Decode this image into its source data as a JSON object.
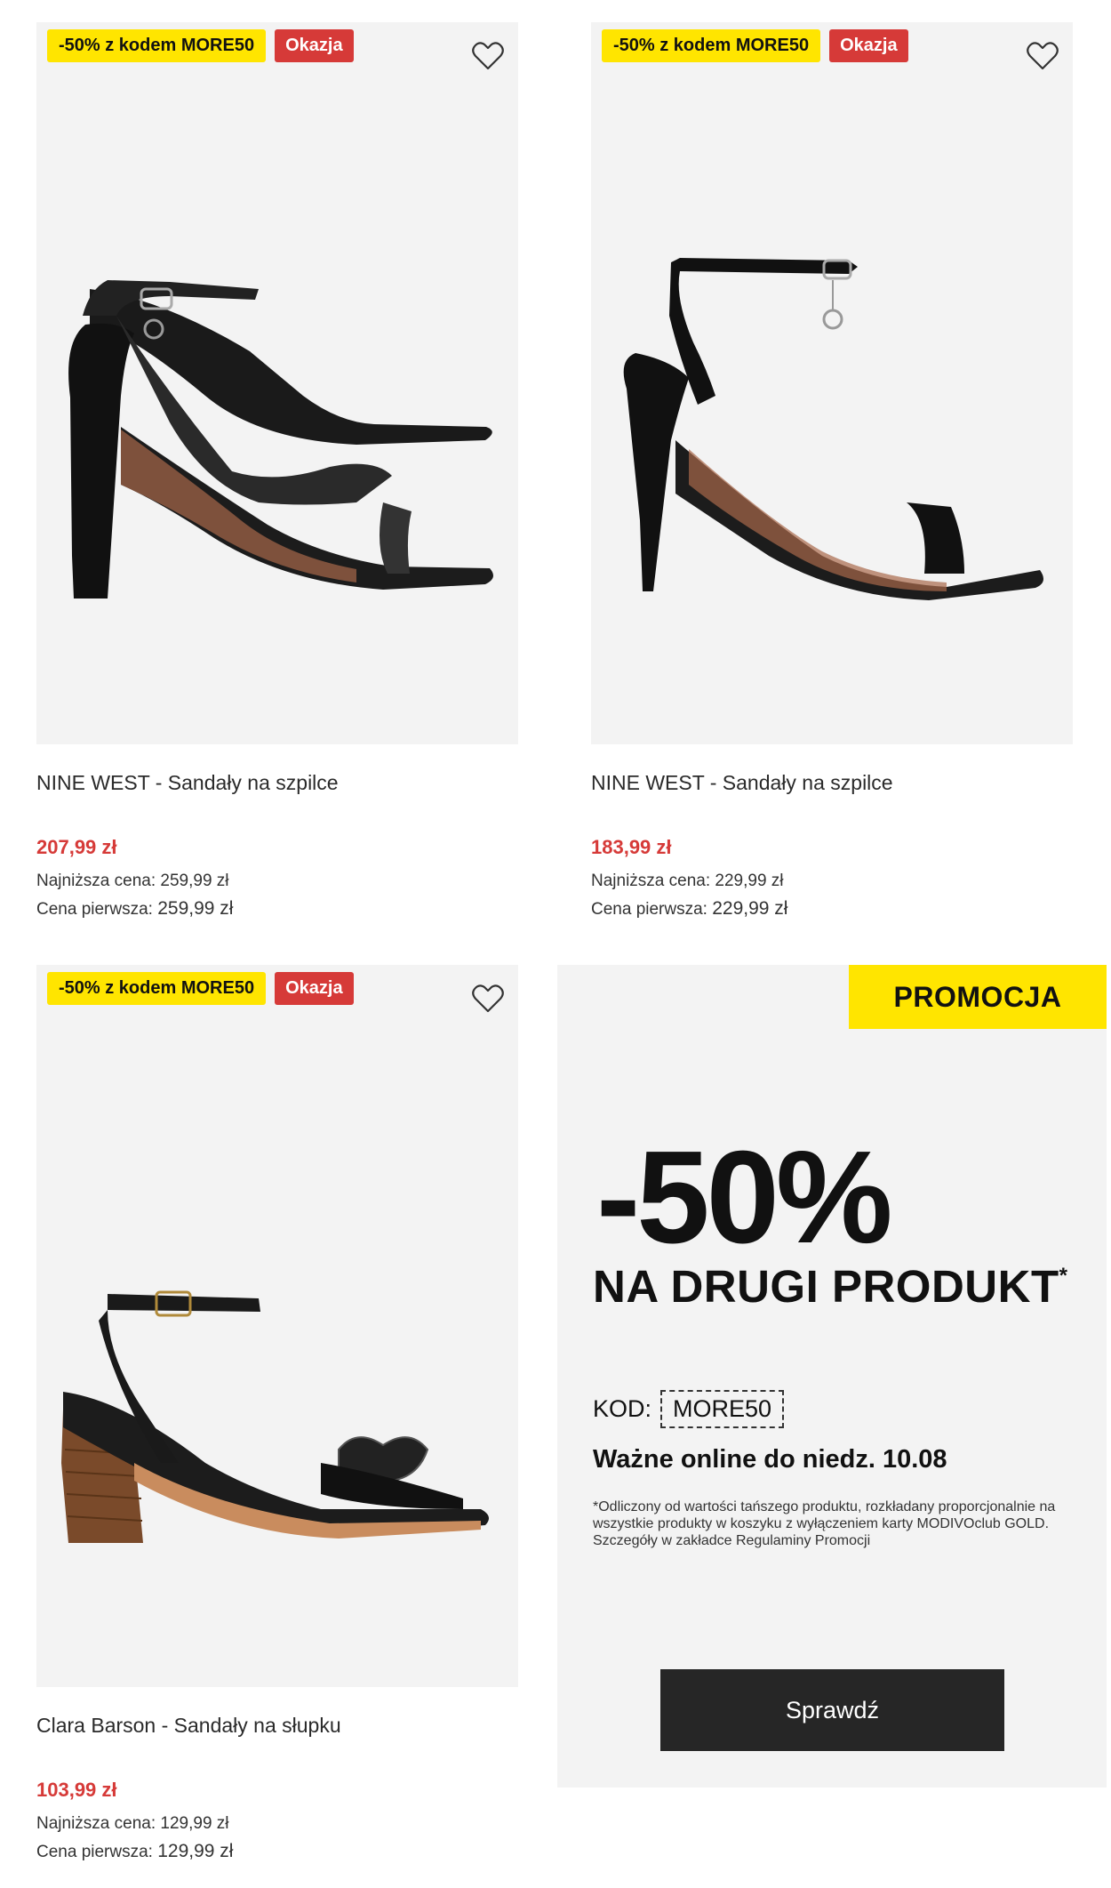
{
  "products": [
    {
      "badge_code": "-50% z kodem MORE50",
      "badge_deal": "Okazja",
      "title": "NINE WEST - Sandały na szpilce",
      "price": "207,99 zł",
      "lowest_label": "Najniższa cena:",
      "lowest_value": "259,99 zł",
      "first_label": "Cena pierwsza:",
      "first_value": "259,99 zł"
    },
    {
      "badge_code": "-50% z kodem MORE50",
      "badge_deal": "Okazja",
      "title": "NINE WEST - Sandały na szpilce",
      "price": "183,99 zł",
      "lowest_label": "Najniższa cena:",
      "lowest_value": "229,99 zł",
      "first_label": "Cena pierwsza:",
      "first_value": "229,99 zł"
    },
    {
      "badge_code": "-50% z kodem MORE50",
      "badge_deal": "Okazja",
      "title": "Clara Barson - Sandały na słupku",
      "price": "103,99 zł",
      "lowest_label": "Najniższa cena:",
      "lowest_value": "129,99 zł",
      "first_label": "Cena pierwsza:",
      "first_value": "129,99 zł"
    }
  ],
  "promo": {
    "tag": "PROMOCJA",
    "percent": "-50%",
    "headline": "NA DRUGI PRODUKT",
    "asterisk": "*",
    "code_label": "KOD:",
    "code": "MORE50",
    "valid": "Ważne online do niedz. 10.08",
    "fine_print": "*Odliczony od wartości tańszego produktu, rozkładany proporcjonalnie na wszystkie produkty w koszyku z wyłączeniem karty MODIVOclub GOLD. Szczegóły w zakładce Regulaminy Promocji",
    "cta": "Sprawdź"
  },
  "colors": {
    "badge_yellow": "#ffe500",
    "badge_red": "#d63a38",
    "price_red": "#d63a38",
    "image_bg": "#f3f3f3",
    "cta_bg": "#262626"
  },
  "icons": [
    "heart-icon"
  ]
}
